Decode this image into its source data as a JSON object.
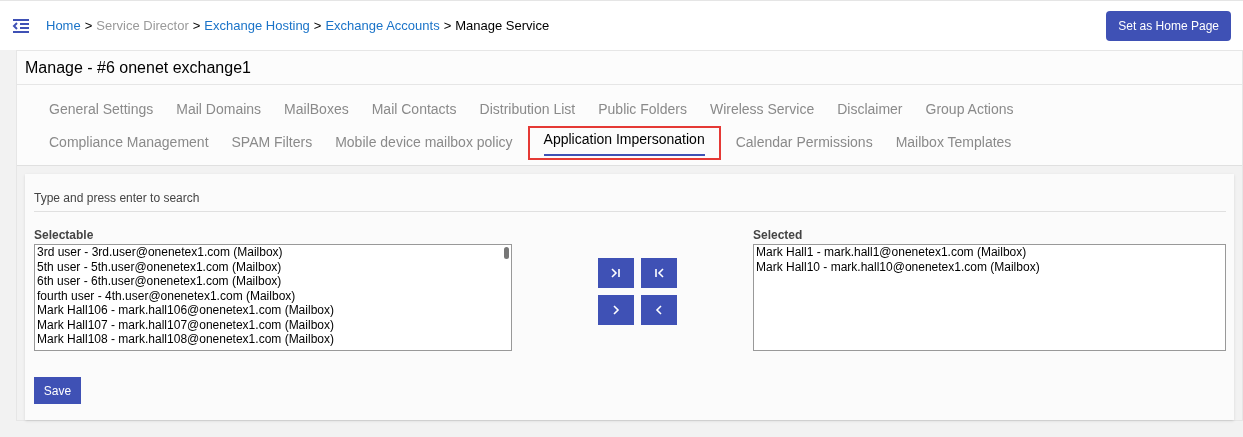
{
  "breadcrumb": [
    {
      "label": "Home",
      "kind": "link"
    },
    {
      "label": ">",
      "kind": "separator"
    },
    {
      "label": "Service Director",
      "kind": "muted"
    },
    {
      "label": ">",
      "kind": "separator"
    },
    {
      "label": "Exchange Hosting",
      "kind": "link"
    },
    {
      "label": ">",
      "kind": "separator"
    },
    {
      "label": "Exchange Accounts",
      "kind": "link"
    },
    {
      "label": ">",
      "kind": "separator"
    },
    {
      "label": "Manage Service",
      "kind": "current"
    }
  ],
  "home_button": "Set as Home Page",
  "title": "Manage - #6 onenet exchange1",
  "tab_rows": [
    [
      {
        "label": "General Settings",
        "selected": false
      },
      {
        "label": "Mail Domains",
        "selected": false
      },
      {
        "label": "MailBoxes",
        "selected": false
      },
      {
        "label": "Mail Contacts",
        "selected": false
      },
      {
        "label": "Distribution List",
        "selected": false
      },
      {
        "label": "Public Folders",
        "selected": false
      },
      {
        "label": "Wireless Service",
        "selected": false
      },
      {
        "label": "Disclaimer",
        "selected": false
      },
      {
        "label": "Group Actions",
        "selected": false
      }
    ],
    [
      {
        "label": "Compliance Management",
        "selected": false
      },
      {
        "label": "SPAM Filters",
        "selected": false
      },
      {
        "label": "Mobile device mailbox policy",
        "selected": false
      },
      {
        "label": "Application Impersonation",
        "selected": true
      },
      {
        "label": "Calendar Permissions",
        "selected": false
      },
      {
        "label": "Mailbox Templates",
        "selected": false
      }
    ]
  ],
  "search": {
    "placeholder": "Type and press enter to search"
  },
  "selectable": {
    "label": "Selectable",
    "items": [
      "3rd user - 3rd.user@onenetex1.com (Mailbox)",
      "5th user - 5th.user@onenetex1.com (Mailbox)",
      "6th user - 6th.user@onenetex1.com (Mailbox)",
      "fourth user - 4th.user@onenetex1.com (Mailbox)",
      "Mark Hall106 - mark.hall106@onenetex1.com (Mailbox)",
      "Mark Hall107 - mark.hall107@onenetex1.com (Mailbox)",
      "Mark Hall108 - mark.hall108@onenetex1.com (Mailbox)"
    ]
  },
  "move_buttons": [
    {
      "kind": "all-right"
    },
    {
      "kind": "all-left"
    },
    {
      "kind": "right"
    },
    {
      "kind": "left"
    }
  ],
  "selected": {
    "label": "Selected",
    "items": [
      "Mark Hall1 - mark.hall1@onenetex1.com (Mailbox)",
      "Mark Hall10 - mark.hall10@onenetex1.com (Mailbox)"
    ]
  },
  "save_button": "Save"
}
